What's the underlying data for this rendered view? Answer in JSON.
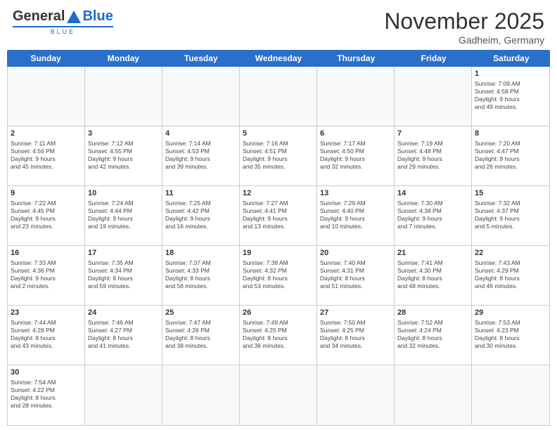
{
  "header": {
    "logo": {
      "general": "General",
      "blue": "Blue",
      "tagline": "Blue"
    },
    "title": "November 2025",
    "location": "Gadheim, Germany"
  },
  "days_of_week": [
    "Sunday",
    "Monday",
    "Tuesday",
    "Wednesday",
    "Thursday",
    "Friday",
    "Saturday"
  ],
  "weeks": [
    [
      {
        "day": "",
        "info": "",
        "empty": true
      },
      {
        "day": "",
        "info": "",
        "empty": true
      },
      {
        "day": "",
        "info": "",
        "empty": true
      },
      {
        "day": "",
        "info": "",
        "empty": true
      },
      {
        "day": "",
        "info": "",
        "empty": true
      },
      {
        "day": "",
        "info": "",
        "empty": true
      },
      {
        "day": "1",
        "info": "Sunrise: 7:09 AM\nSunset: 4:58 PM\nDaylight: 9 hours\nand 49 minutes.",
        "empty": false
      }
    ],
    [
      {
        "day": "2",
        "info": "Sunrise: 7:11 AM\nSunset: 4:56 PM\nDaylight: 9 hours\nand 45 minutes.",
        "empty": false
      },
      {
        "day": "3",
        "info": "Sunrise: 7:12 AM\nSunset: 4:55 PM\nDaylight: 9 hours\nand 42 minutes.",
        "empty": false
      },
      {
        "day": "4",
        "info": "Sunrise: 7:14 AM\nSunset: 4:53 PM\nDaylight: 9 hours\nand 39 minutes.",
        "empty": false
      },
      {
        "day": "5",
        "info": "Sunrise: 7:16 AM\nSunset: 4:51 PM\nDaylight: 9 hours\nand 35 minutes.",
        "empty": false
      },
      {
        "day": "6",
        "info": "Sunrise: 7:17 AM\nSunset: 4:50 PM\nDaylight: 9 hours\nand 32 minutes.",
        "empty": false
      },
      {
        "day": "7",
        "info": "Sunrise: 7:19 AM\nSunset: 4:48 PM\nDaylight: 9 hours\nand 29 minutes.",
        "empty": false
      },
      {
        "day": "8",
        "info": "Sunrise: 7:20 AM\nSunset: 4:47 PM\nDaylight: 9 hours\nand 26 minutes.",
        "empty": false
      }
    ],
    [
      {
        "day": "9",
        "info": "Sunrise: 7:22 AM\nSunset: 4:45 PM\nDaylight: 9 hours\nand 23 minutes.",
        "empty": false
      },
      {
        "day": "10",
        "info": "Sunrise: 7:24 AM\nSunset: 4:44 PM\nDaylight: 9 hours\nand 19 minutes.",
        "empty": false
      },
      {
        "day": "11",
        "info": "Sunrise: 7:25 AM\nSunset: 4:42 PM\nDaylight: 9 hours\nand 16 minutes.",
        "empty": false
      },
      {
        "day": "12",
        "info": "Sunrise: 7:27 AM\nSunset: 4:41 PM\nDaylight: 9 hours\nand 13 minutes.",
        "empty": false
      },
      {
        "day": "13",
        "info": "Sunrise: 7:29 AM\nSunset: 4:40 PM\nDaylight: 9 hours\nand 10 minutes.",
        "empty": false
      },
      {
        "day": "14",
        "info": "Sunrise: 7:30 AM\nSunset: 4:38 PM\nDaylight: 9 hours\nand 7 minutes.",
        "empty": false
      },
      {
        "day": "15",
        "info": "Sunrise: 7:32 AM\nSunset: 4:37 PM\nDaylight: 9 hours\nand 5 minutes.",
        "empty": false
      }
    ],
    [
      {
        "day": "16",
        "info": "Sunrise: 7:33 AM\nSunset: 4:36 PM\nDaylight: 9 hours\nand 2 minutes.",
        "empty": false
      },
      {
        "day": "17",
        "info": "Sunrise: 7:35 AM\nSunset: 4:34 PM\nDaylight: 8 hours\nand 59 minutes.",
        "empty": false
      },
      {
        "day": "18",
        "info": "Sunrise: 7:37 AM\nSunset: 4:33 PM\nDaylight: 8 hours\nand 56 minutes.",
        "empty": false
      },
      {
        "day": "19",
        "info": "Sunrise: 7:38 AM\nSunset: 4:32 PM\nDaylight: 8 hours\nand 53 minutes.",
        "empty": false
      },
      {
        "day": "20",
        "info": "Sunrise: 7:40 AM\nSunset: 4:31 PM\nDaylight: 8 hours\nand 51 minutes.",
        "empty": false
      },
      {
        "day": "21",
        "info": "Sunrise: 7:41 AM\nSunset: 4:30 PM\nDaylight: 8 hours\nand 48 minutes.",
        "empty": false
      },
      {
        "day": "22",
        "info": "Sunrise: 7:43 AM\nSunset: 4:29 PM\nDaylight: 8 hours\nand 46 minutes.",
        "empty": false
      }
    ],
    [
      {
        "day": "23",
        "info": "Sunrise: 7:44 AM\nSunset: 4:28 PM\nDaylight: 8 hours\nand 43 minutes.",
        "empty": false
      },
      {
        "day": "24",
        "info": "Sunrise: 7:46 AM\nSunset: 4:27 PM\nDaylight: 8 hours\nand 41 minutes.",
        "empty": false
      },
      {
        "day": "25",
        "info": "Sunrise: 7:47 AM\nSunset: 4:26 PM\nDaylight: 8 hours\nand 38 minutes.",
        "empty": false
      },
      {
        "day": "26",
        "info": "Sunrise: 7:49 AM\nSunset: 4:25 PM\nDaylight: 8 hours\nand 36 minutes.",
        "empty": false
      },
      {
        "day": "27",
        "info": "Sunrise: 7:50 AM\nSunset: 4:25 PM\nDaylight: 8 hours\nand 34 minutes.",
        "empty": false
      },
      {
        "day": "28",
        "info": "Sunrise: 7:52 AM\nSunset: 4:24 PM\nDaylight: 8 hours\nand 32 minutes.",
        "empty": false
      },
      {
        "day": "29",
        "info": "Sunrise: 7:53 AM\nSunset: 4:23 PM\nDaylight: 8 hours\nand 30 minutes.",
        "empty": false
      }
    ],
    [
      {
        "day": "30",
        "info": "Sunrise: 7:54 AM\nSunset: 4:22 PM\nDaylight: 8 hours\nand 28 minutes.",
        "empty": false
      },
      {
        "day": "",
        "info": "",
        "empty": true
      },
      {
        "day": "",
        "info": "",
        "empty": true
      },
      {
        "day": "",
        "info": "",
        "empty": true
      },
      {
        "day": "",
        "info": "",
        "empty": true
      },
      {
        "day": "",
        "info": "",
        "empty": true
      },
      {
        "day": "",
        "info": "",
        "empty": true
      }
    ]
  ]
}
